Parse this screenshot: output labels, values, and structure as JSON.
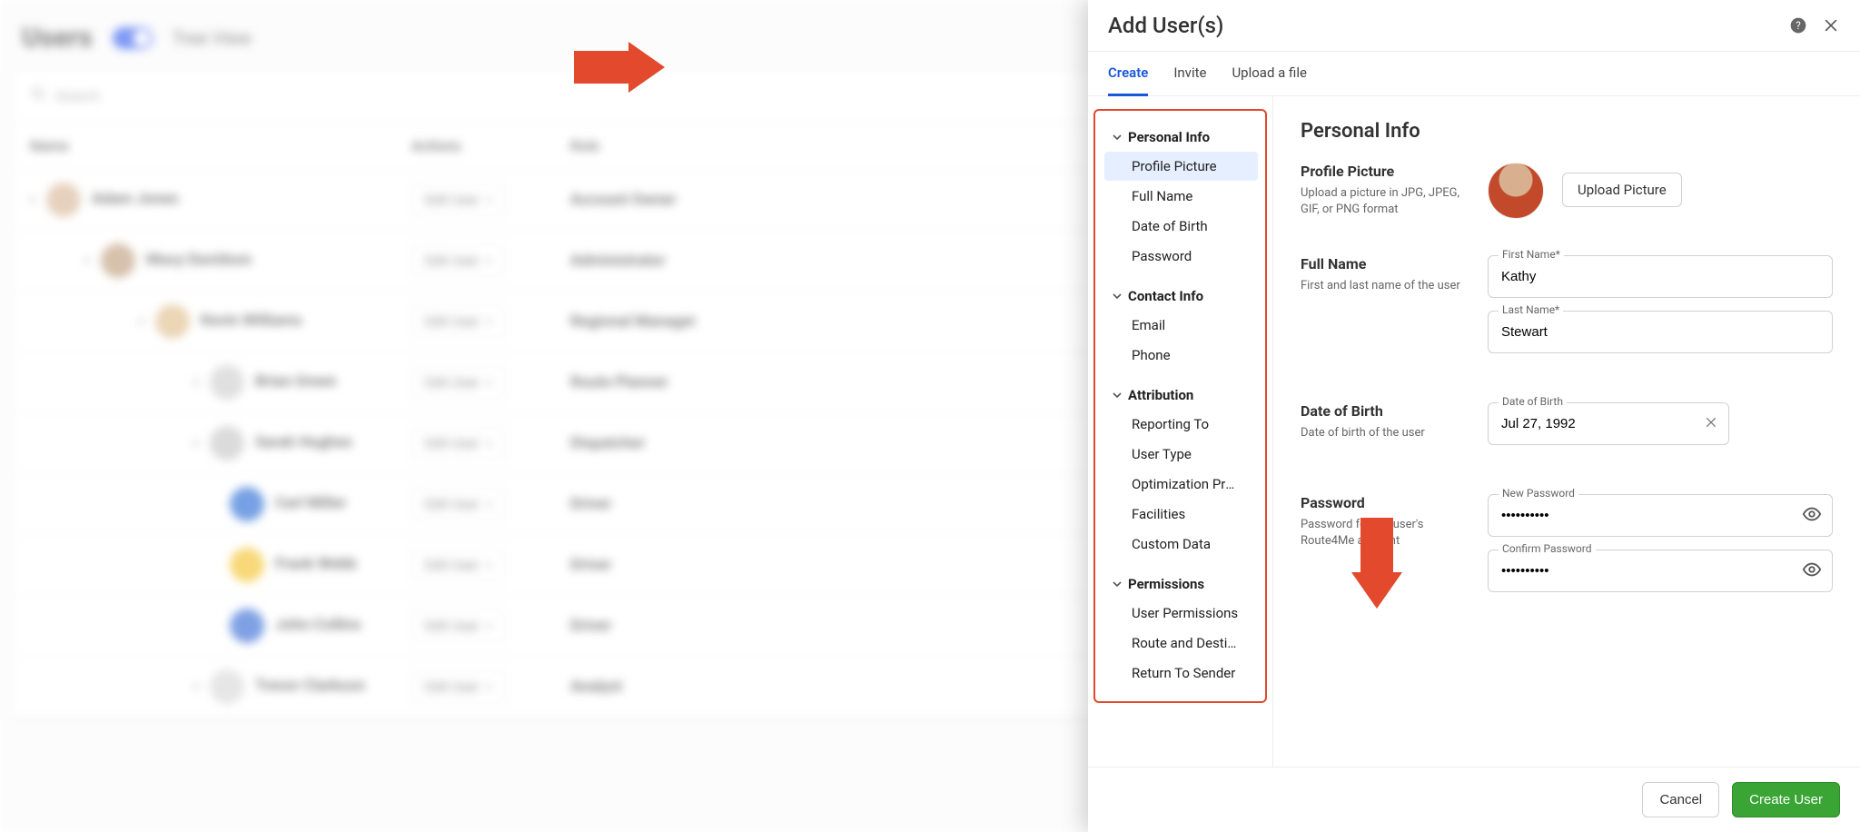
{
  "bg": {
    "title": "Users",
    "toggle_label": "Tree View",
    "search_placeholder": "Search",
    "cols": {
      "name": "Name",
      "actions": "Actions",
      "role": "Role"
    },
    "action_label": "Edit User",
    "rows": [
      {
        "name": "Adam Jones",
        "role": "Account Owner",
        "indent": 0
      },
      {
        "name": "Macy Davidson",
        "role": "Administrator",
        "indent": 1
      },
      {
        "name": "Kevin Williams",
        "role": "Regional Manager",
        "indent": 2
      },
      {
        "name": "Brian Green",
        "role": "Route Planner",
        "indent": 3
      },
      {
        "name": "Sarah Hughes",
        "role": "Dispatcher",
        "indent": 3
      },
      {
        "name": "Carl Miller",
        "role": "Driver",
        "indent": 4
      },
      {
        "name": "Frank Webb",
        "role": "Driver",
        "indent": 4
      },
      {
        "name": "John Collins",
        "role": "Driver",
        "indent": 4
      },
      {
        "name": "Trevor Clarkson",
        "role": "Analyst",
        "indent": 3
      }
    ]
  },
  "drawer": {
    "title": "Add User(s)",
    "tabs": {
      "create": "Create",
      "invite": "Invite",
      "upload": "Upload a file"
    },
    "side": {
      "g1": "Personal Info",
      "g1_items": {
        "pp": "Profile Picture",
        "fn": "Full Name",
        "dob": "Date of Birth",
        "pwd": "Password"
      },
      "g2": "Contact Info",
      "g2_items": {
        "email": "Email",
        "phone": "Phone"
      },
      "g3": "Attribution",
      "g3_items": {
        "rep": "Reporting To",
        "ut": "User Type",
        "opt": "Optimization Profile",
        "fac": "Facilities",
        "cd": "Custom Data"
      },
      "g4": "Permissions",
      "g4_items": {
        "up": "User Permissions",
        "rd": "Route and Destinatio...",
        "rts": "Return To Sender"
      }
    },
    "form": {
      "section_title": "Personal Info",
      "pp_title": "Profile Picture",
      "pp_desc": "Upload a picture in JPG, JPEG, GIF, or PNG format",
      "upload_btn": "Upload Picture",
      "fn_title": "Full Name",
      "fn_desc": "First and last name of the user",
      "first_label": "First Name*",
      "first_value": "Kathy",
      "last_label": "Last Name*",
      "last_value": "Stewart",
      "dob_title": "Date of Birth",
      "dob_desc": "Date of birth of the user",
      "dob_label": "Date of Birth",
      "dob_value": "Jul 27, 1992",
      "pw_title": "Password",
      "pw_desc": "Password for the user's Route4Me account",
      "pw_new_label": "New Password",
      "pw_new_value": "••••••••••",
      "pw_conf_label": "Confirm Password",
      "pw_conf_value": "••••••••••"
    },
    "footer": {
      "cancel": "Cancel",
      "create": "Create User"
    }
  }
}
